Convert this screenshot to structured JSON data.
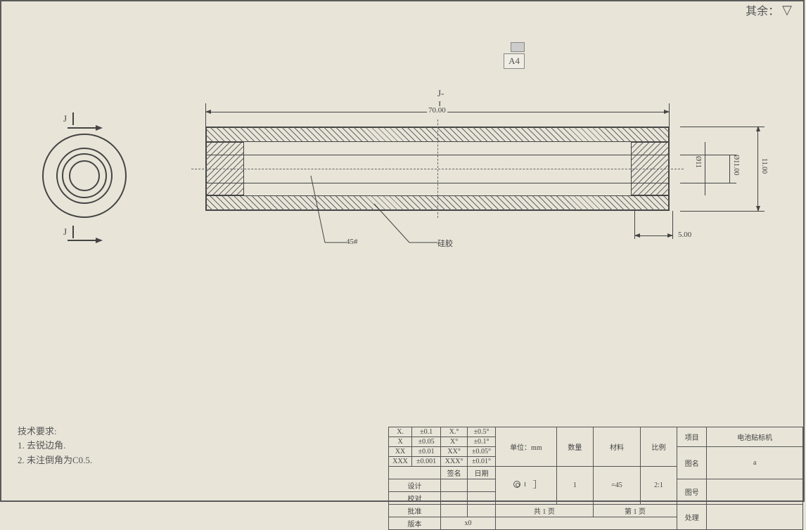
{
  "top_right": {
    "label": "其余："
  },
  "a4_label": "A4",
  "section_view": {
    "label": "J-J",
    "section_letter_top": "J",
    "section_letter_bottom": "J",
    "dim_length": "70.00",
    "dim_dia_inner": "Ø11",
    "dim_dia_bore": "Ø11.00",
    "dim_height": "11.00",
    "dim_depth": "5.00",
    "leader1_text": "45#",
    "leader2_text": "硅胶"
  },
  "tech_requirements": {
    "title": "技术要求:",
    "item1": "1. 去锐边角.",
    "item2": "2. 未注倒角为C0.5."
  },
  "title_block": {
    "tolerance": {
      "r1c1": "X.",
      "r1c2": "±0.1",
      "r1c3": "X.°",
      "r1c4": "±0.5°",
      "r2c1": "X",
      "r2c2": "±0.05",
      "r2c3": "X°",
      "r2c4": "±0.1°",
      "r3c1": "XX",
      "r3c2": "±0.01",
      "r3c3": "XX°",
      "r3c4": "±0.05°",
      "r4c1": "XXX",
      "r4c2": "±0.001",
      "r4c3": "XXX°",
      "r4c4": "±0.01°"
    },
    "signature": "签名",
    "date": "日期",
    "design": "设计",
    "review": "校对",
    "approve": "批准",
    "version": "版本",
    "version_val": "x0",
    "unit_label": "单位：mm",
    "qty_label": "数量",
    "qty_val": "1",
    "material_label": "材料",
    "material_val": "=45",
    "scale_label": "比例",
    "scale_val": "2:1",
    "sheet_total": "共 1 页",
    "sheet_cur": "第 1 页",
    "project_label": "项目",
    "project_val": "电池贴标机",
    "name_label": "图名",
    "name_val": "a",
    "number_label": "图号",
    "treatment_label": "处理"
  }
}
